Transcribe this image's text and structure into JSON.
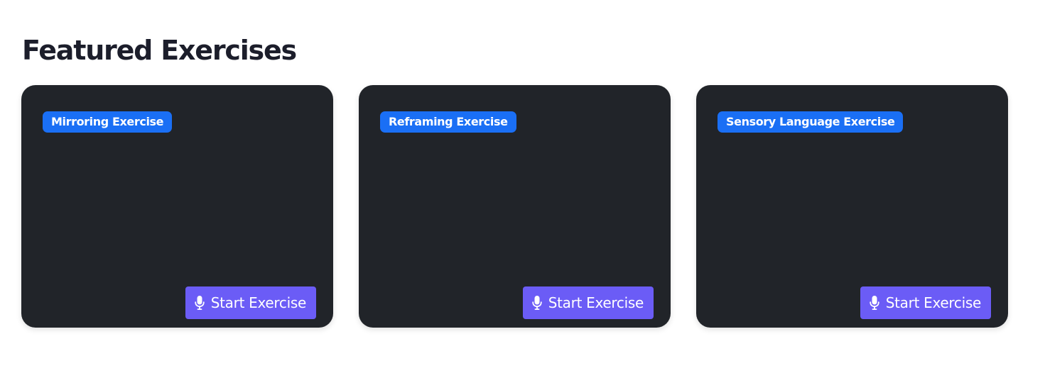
{
  "section": {
    "title": "Featured Exercises"
  },
  "cards": [
    {
      "badge": "Mirroring Exercise",
      "button_label": "Start Exercise",
      "button_icon": "microphone-icon"
    },
    {
      "badge": "Reframing Exercise",
      "button_label": "Start Exercise",
      "button_icon": "microphone-icon"
    },
    {
      "badge": "Sensory Language Exercise",
      "button_label": "Start Exercise",
      "button_icon": "microphone-icon"
    }
  ],
  "colors": {
    "card_background": "#212429",
    "badge_background": "#1a6ff5",
    "button_background": "#6b5cf6",
    "title_text": "#1c1e2b"
  }
}
